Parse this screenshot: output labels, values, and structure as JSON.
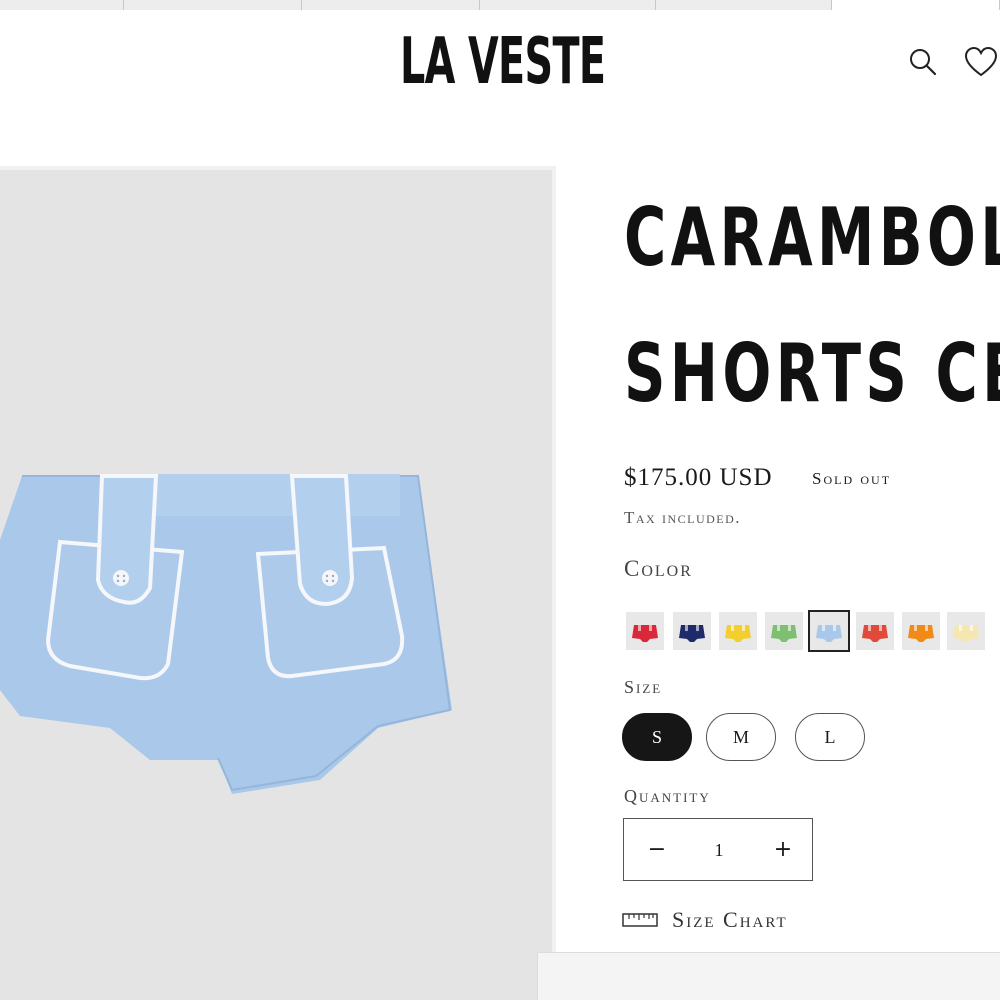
{
  "store": {
    "logo": "LA VESTE"
  },
  "header": {
    "search_icon": "search-icon",
    "wishlist_icon": "heart-icon"
  },
  "product": {
    "title_line1": "CARAMBOLA TOI",
    "title_line2": "SHORTS CELEST",
    "price": "$175.00 USD",
    "status": "Sold out",
    "tax_note": "Tax included.",
    "color_label": "Color",
    "colors": [
      {
        "name": "red",
        "hex": "#d8283a"
      },
      {
        "name": "navy",
        "hex": "#1f2a6b"
      },
      {
        "name": "yellow",
        "hex": "#f2cf2e"
      },
      {
        "name": "green",
        "hex": "#7fbf72"
      },
      {
        "name": "light-blue",
        "hex": "#a9c8ea",
        "selected": true
      },
      {
        "name": "tomato",
        "hex": "#e04a3a"
      },
      {
        "name": "orange",
        "hex": "#f08a18"
      },
      {
        "name": "cream",
        "hex": "#f6e6b0"
      }
    ],
    "size_label": "Size",
    "sizes": [
      "S",
      "M",
      "L"
    ],
    "selected_size": "S",
    "quantity_label": "Quantity",
    "quantity": "1",
    "quantity_minus": "−",
    "quantity_plus": "+",
    "size_chart_label": "Size Chart"
  }
}
